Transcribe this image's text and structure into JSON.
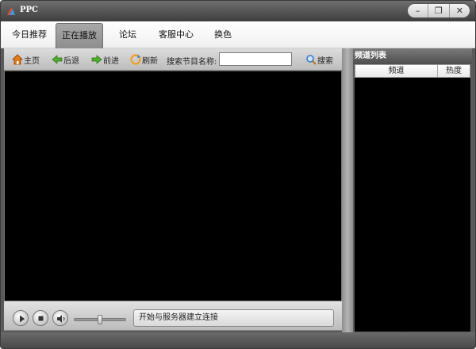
{
  "window": {
    "title": "PPC",
    "controls": {
      "minimize": "–",
      "restore": "❐",
      "close": "✕"
    }
  },
  "tabs": [
    {
      "label": "今日推荐",
      "active": false
    },
    {
      "label": "正在播放",
      "active": true
    },
    {
      "label": "论坛",
      "active": false
    },
    {
      "label": "客服中心",
      "active": false
    },
    {
      "label": "换色",
      "active": false
    }
  ],
  "toolbar": {
    "home": "主页",
    "back": "后退",
    "forward": "前进",
    "refresh": "刷新",
    "search_caption": "搜索节目名称:",
    "search_value": "",
    "search_button": "搜索"
  },
  "player": {
    "status_text": "开始与服务器建立连接",
    "volume_level": 0.5
  },
  "channel_panel": {
    "title": "频道列表",
    "columns": [
      "频道",
      "热度"
    ],
    "rows": []
  },
  "colors": {
    "title_bar": "#4e4e4e",
    "video_background": "#000000",
    "active_tab": "#9a9a9a",
    "home_icon": "#e07a1a",
    "back_arrow": "#4fb02b",
    "forward_arrow": "#4fb02b",
    "refresh_icon": "#f0a020",
    "search_icon": "#3b7bd0"
  }
}
